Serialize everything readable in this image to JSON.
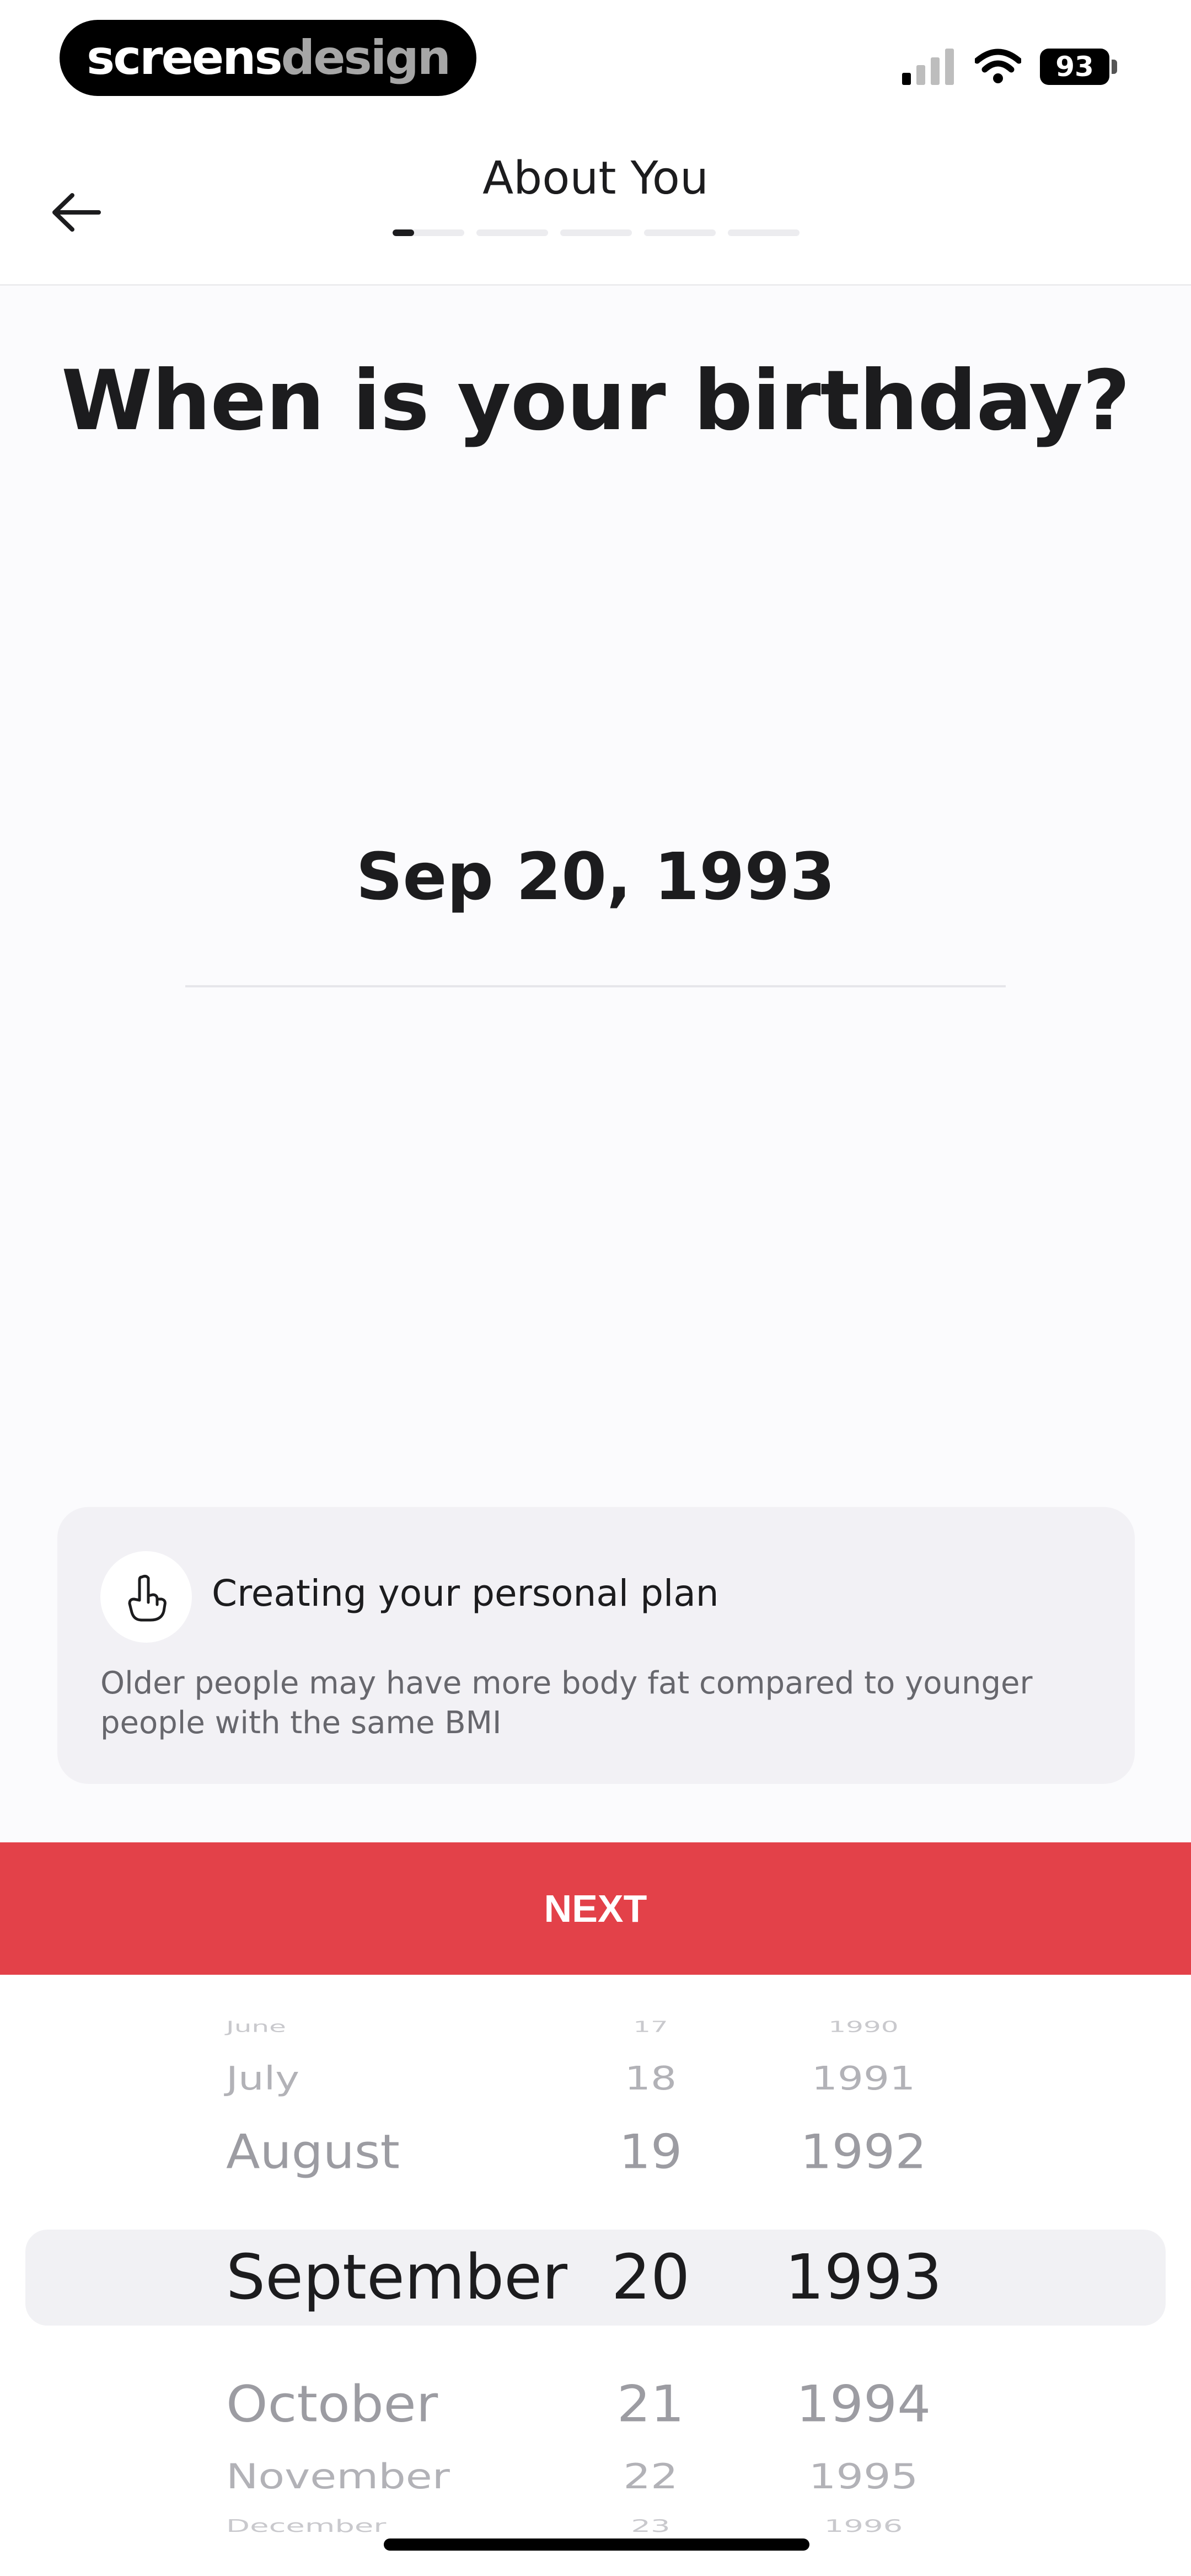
{
  "status_bar": {
    "brand_part1": "screens",
    "brand_part2": "design",
    "battery": "93"
  },
  "header": {
    "title": "About You",
    "progress_steps": 5,
    "current_step": 1,
    "current_step_fraction": 0.3
  },
  "question": "When is your birthday?",
  "selected_date": "Sep 20, 1993",
  "tip": {
    "title": "Creating your personal plan",
    "body": "Older people may have more body fat compared to younger people with the same BMI",
    "icon": "pointing-hand-icon"
  },
  "next_button": "NEXT",
  "picker": {
    "months": [
      "June",
      "July",
      "August",
      "September",
      "October",
      "November",
      "December"
    ],
    "days": [
      "17",
      "18",
      "19",
      "20",
      "21",
      "22",
      "23"
    ],
    "years": [
      "1990",
      "1991",
      "1992",
      "1993",
      "1994",
      "1995",
      "1996"
    ],
    "selected_index": 3
  },
  "colors": {
    "accent": "#e34149",
    "text": "#1c1c1e",
    "muted": "#67676d"
  }
}
